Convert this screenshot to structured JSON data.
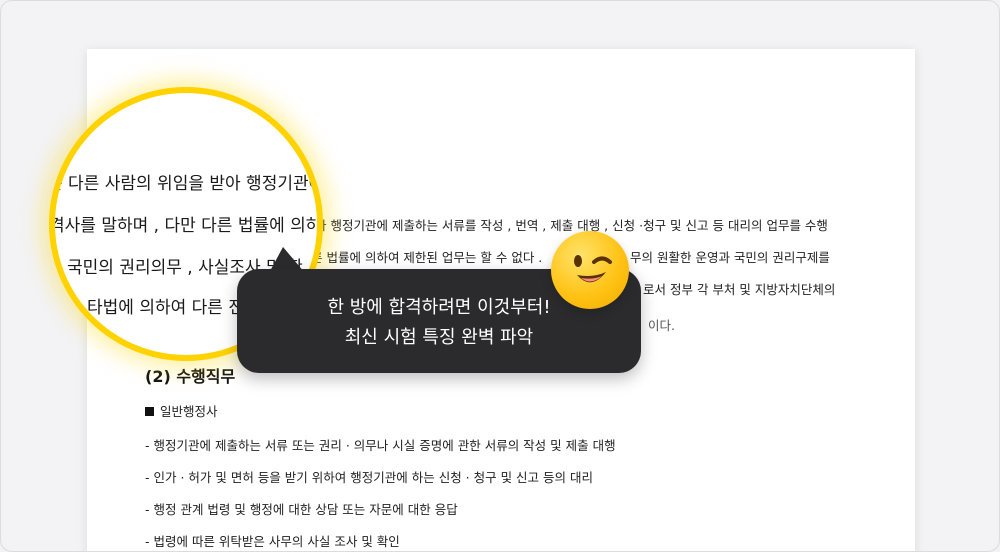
{
  "document": {
    "lines": [
      "아 행정기관에 제출하는 서류를 작성 , 번역 , 제출 대행 , 신청 ·청구 및 신고 등 대리의 업무를 수행",
      "른 법률에 의하여 제한된 업무는 할 수 없다 .",
      "무의 원활한 운영과 국민의 권리구제를",
      "로서 정부 각 부처 및 지방자치단체의",
      "이다."
    ],
    "section_title": "(2) 수행직무",
    "subsection": "일반행정사",
    "items": [
      "- 행정기관에 제출하는 서류 또는 권리 ·  의무나 시실 증명에 관한 서류의 작성 및 제출 대행",
      "- 인가 ·  허가 및 면허 등을 받기 위하여 행정기관에 하는 신청 ·  청구 및 신고 등의 대리",
      "- 행정 관계 법령 및 행정에 대한 상담 또는 자문에 대한 응답",
      "- 법령에 따른 위탁받은 사무의 사실 조사 및 확인"
    ]
  },
  "magnifier": {
    "lines": [
      "는 다른 사람의 위임을 받아 행정기관에",
      "격사를 말하며 , 다만 다른 법률에 의하여",
      "국민의 권리의무 , 사실조사 및 확",
      "타법에 의하여 다른 전"
    ]
  },
  "callout": {
    "line1": "한 방에 합격하려면 이것부터!",
    "line2": "최신 시험 특징 완벽 파악"
  },
  "colors": {
    "highlight_ring": "#ffd200",
    "callout_bg": "#2b2b2d",
    "emoji": "#ffc316"
  },
  "icons": {
    "emoji": "winking-face-icon"
  }
}
